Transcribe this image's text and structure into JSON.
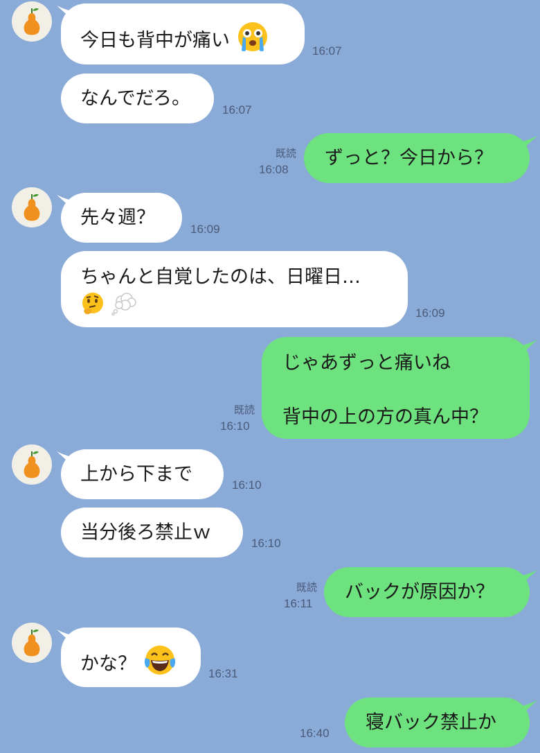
{
  "colors": {
    "background": "#8aaad8",
    "incoming_bubble": "#ffffff",
    "outgoing_bubble": "#6ee27e",
    "timestamp": "#4a5a78",
    "avatar_bg": "#f2f0e6",
    "pear": "#f0901e"
  },
  "contact": {
    "avatar_icon": "pear-icon"
  },
  "messages": [
    {
      "text": "今日も背中が痛い",
      "emoji": "crying-face-emoji",
      "time": "16:07"
    },
    {
      "text": "なんでだろ。",
      "time": "16:07"
    },
    {
      "text": "ずっと？今日から？",
      "time": "16:08",
      "read": "既読"
    },
    {
      "text": "先々週？",
      "time": "16:09"
    },
    {
      "line1": "ちゃんと自覚したのは、日曜日…",
      "emoji": "thinking-face-emoji, thought-balloon-emoji",
      "time": "16:09"
    },
    {
      "line1": "じゃあずっと痛いね",
      "line2": "背中の上の方の真ん中？",
      "time": "16:10",
      "read": "既読"
    },
    {
      "text": "上から下まで",
      "time": "16:10"
    },
    {
      "text": "当分後ろ禁止ｗ",
      "time": "16:10"
    },
    {
      "text": "バックが原因か？",
      "time": "16:11",
      "read": "既読"
    },
    {
      "text": "かな？",
      "emoji": "laughing-crying-face-emoji",
      "time": "16:31"
    },
    {
      "text": "寝バック禁止か",
      "time": "16:40"
    }
  ]
}
